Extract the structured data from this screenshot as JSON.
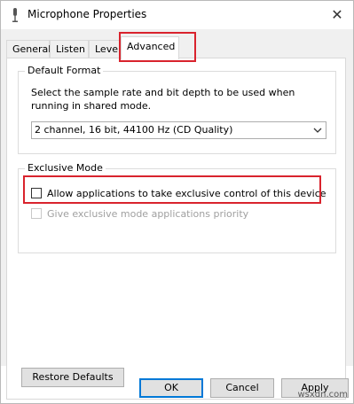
{
  "window": {
    "title": "Microphone Properties",
    "title_icon": "microphone-icon",
    "close_icon": "close-icon",
    "close_glyph": "✕"
  },
  "tabs": [
    {
      "label": "General",
      "active": false
    },
    {
      "label": "Listen",
      "active": false
    },
    {
      "label": "Levels",
      "active": false
    },
    {
      "label": "Advanced",
      "active": true
    }
  ],
  "default_format": {
    "group_label": "Default Format",
    "description": "Select the sample rate and bit depth to be used when running in shared mode.",
    "selected_format": "2 channel, 16 bit, 44100 Hz (CD Quality)",
    "dropdown_icon": "chevron-down-icon"
  },
  "exclusive_mode": {
    "group_label": "Exclusive Mode",
    "allow_exclusive_label": "Allow applications to take exclusive control of this device",
    "allow_exclusive_checked": false,
    "priority_label": "Give exclusive mode applications priority",
    "priority_checked": false,
    "priority_enabled": false
  },
  "buttons": {
    "restore_defaults": "Restore Defaults",
    "ok": "OK",
    "cancel": "Cancel",
    "apply": "Apply"
  },
  "watermark": "wsxdn.com",
  "colors": {
    "highlight": "#d9232d",
    "default_button_border": "#0078d7",
    "dialog_background": "#f0f0f0"
  }
}
